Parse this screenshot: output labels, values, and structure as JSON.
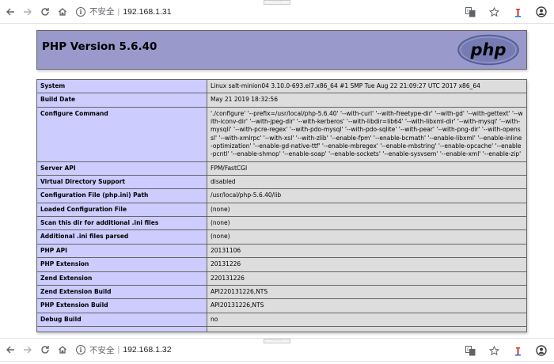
{
  "browser_top": {
    "url_label": "不安全",
    "url": "192.168.1.31"
  },
  "browser_bottom": {
    "url_label": "不安全",
    "url": "192.168.1.32"
  },
  "phpinfo": {
    "title": "PHP Version 5.6.40",
    "logo_text": "php",
    "rows": [
      {
        "key": "System",
        "value": "Linux salt-minion04 3.10.0-693.el7.x86_64 #1 SMP Tue Aug 22 21:09:27 UTC 2017 x86_64"
      },
      {
        "key": "Build Date",
        "value": "May 21 2019 18:32:56"
      },
      {
        "key": "Configure Command",
        "value": "'./configure' '--prefix=/usr/local/php-5.6.40' '--with-curl' '--with-freetype-dir' '--with-gd' '--with-gettext' '--with-iconv-dir' '--with-jpeg-dir' '--with-kerberos' '--with-libdir=lib64' '--with-libxml-dir' '--with-mysql' '--with-mysqli' '--with-pcre-regex' '--with-pdo-mysql' '--with-pdo-sqlite' '--with-pear' '--with-png-dir' '--with-openssl' '--with-xmlrpc' '--with-xsl' '--with-zlib' '--enable-fpm' '--enable-bcmath' '--enable-libxml' '--enable-inline-optimization' '--enable-gd-native-ttf' '--enable-mbregex' '--enable-mbstring' '--enable-opcache' '--enable-pcntl' '--enable-shmop' '--enable-soap' '--enable-sockets' '--enable-sysvsem' '--enable-xml' '--enable-zip'"
      },
      {
        "key": "Server API",
        "value": "FPM/FastCGI"
      },
      {
        "key": "Virtual Directory Support",
        "value": "disabled"
      },
      {
        "key": "Configuration File (php.ini) Path",
        "value": "/usr/local/php-5.6.40/lib"
      },
      {
        "key": "Loaded Configuration File",
        "value": "(none)"
      },
      {
        "key": "Scan this dir for additional .ini files",
        "value": "(none)"
      },
      {
        "key": "Additional .ini files parsed",
        "value": "(none)"
      },
      {
        "key": "PHP API",
        "value": "20131106"
      },
      {
        "key": "PHP Extension",
        "value": "20131226"
      },
      {
        "key": "Zend Extension",
        "value": "220131226"
      },
      {
        "key": "Zend Extension Build",
        "value": "API220131226,NTS"
      },
      {
        "key": "PHP Extension Build",
        "value": "API20131226,NTS"
      },
      {
        "key": "Debug Build",
        "value": "no"
      },
      {
        "key": "",
        "value": ""
      }
    ]
  },
  "colors": {
    "header_bg": "#9999cc",
    "key_bg": "#ccccff",
    "value_bg": "#dddddd",
    "logo_bg": "#777bb3"
  },
  "icons": [
    "back-arrow-icon",
    "forward-arrow-icon",
    "reload-icon",
    "home-icon",
    "info-icon",
    "translate-icon",
    "star-icon",
    "extension-icon",
    "profile-icon"
  ]
}
